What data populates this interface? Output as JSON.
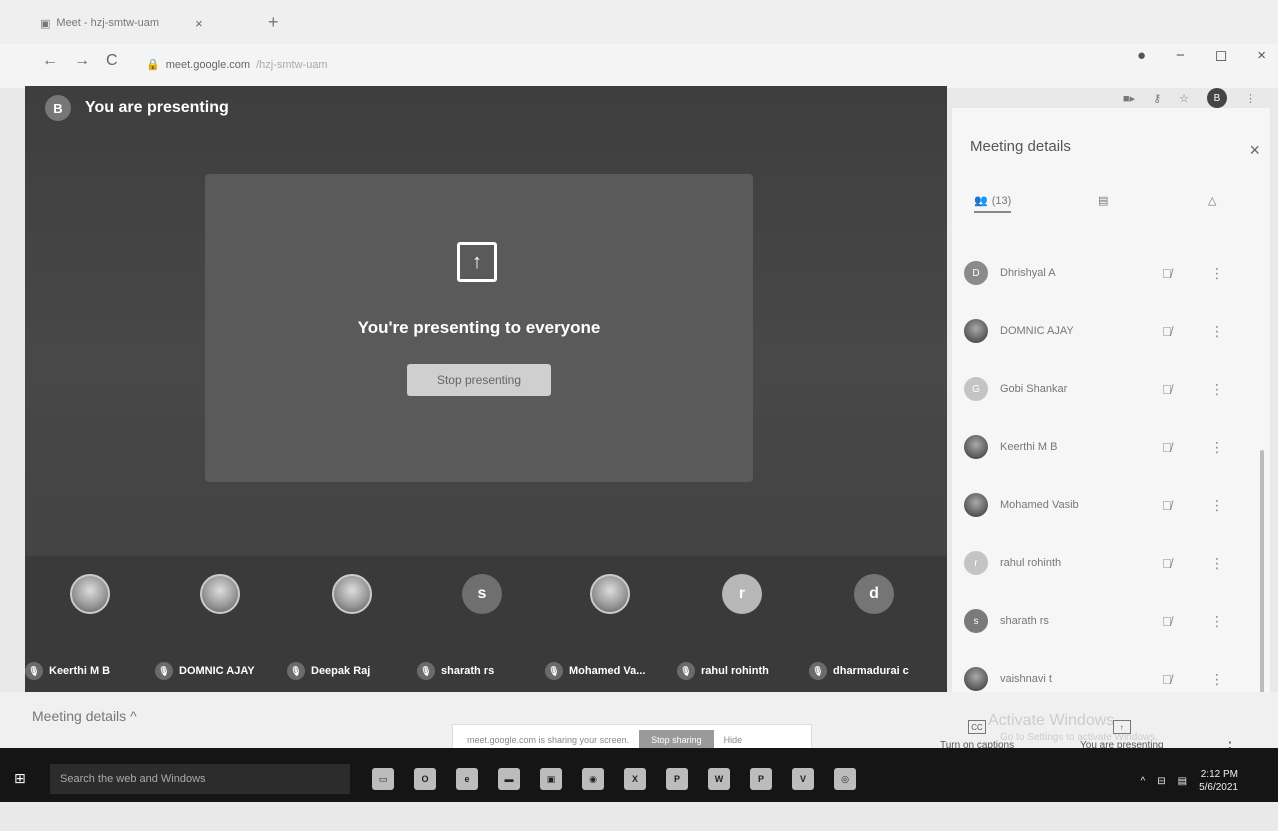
{
  "browser": {
    "tab_title": "Meet - hzj-smtw-uam",
    "tab_close": "×",
    "new_tab": "+",
    "url_host": "meet.google.com",
    "url_path": "/hzj-smtw-uam",
    "nav_back": "←",
    "nav_forward": "→",
    "nav_reload": "C",
    "profile_initial": "B",
    "window_min": "−",
    "window_max": "◻",
    "window_close": "×"
  },
  "stage": {
    "presenter_initial": "B",
    "banner_text": "You are presenting",
    "present_title": "You're presenting to everyone",
    "stop_presenting_label": "Stop presenting",
    "participants": [
      {
        "name": "Keerthi M B",
        "initial": "",
        "photo": true,
        "color": "#777777"
      },
      {
        "name": "DOMNIC AJAY",
        "initial": "",
        "photo": true,
        "color": "#777777"
      },
      {
        "name": "Deepak Raj",
        "initial": "",
        "photo": true,
        "color": "#777777"
      },
      {
        "name": "sharath rs",
        "initial": "s",
        "photo": false,
        "color": "#6f6f6f"
      },
      {
        "name": "Mohamed Va...",
        "initial": "",
        "photo": true,
        "color": "#777777"
      },
      {
        "name": "rahul rohinth",
        "initial": "r",
        "photo": false,
        "color": "#b7b7b7"
      },
      {
        "name": "dharmadurai c",
        "initial": "d",
        "photo": false,
        "color": "#757575"
      }
    ]
  },
  "panel": {
    "title": "Meeting details",
    "close": "×",
    "people_count": "(13)",
    "people": [
      {
        "name": "Dhrishyal A",
        "initial": "D",
        "photo": false,
        "color": "#8a8a8a"
      },
      {
        "name": "DOMNIC AJAY",
        "initial": "",
        "photo": true,
        "color": "#777777"
      },
      {
        "name": "Gobi Shankar",
        "initial": "G",
        "photo": false,
        "color": "#c4c4c4"
      },
      {
        "name": "Keerthi M B",
        "initial": "",
        "photo": true,
        "color": "#777777"
      },
      {
        "name": "Mohamed Vasib",
        "initial": "",
        "photo": true,
        "color": "#777777"
      },
      {
        "name": "rahul rohinth",
        "initial": "r",
        "photo": false,
        "color": "#c4c4c4"
      },
      {
        "name": "sharath rs",
        "initial": "s",
        "photo": false,
        "color": "#7a7a7a"
      },
      {
        "name": "vaishnavi t",
        "initial": "",
        "photo": true,
        "color": "#777777"
      }
    ]
  },
  "bottom": {
    "meeting_details": "Meeting details",
    "share_text": "meet.google.com is sharing your screen.",
    "stop_sharing": "Stop sharing",
    "hide": "Hide",
    "captions": "Turn on captions",
    "presenting": "You are presenting",
    "activate_title": "Activate Windows",
    "activate_sub": "Go to Settings to activate Windows."
  },
  "taskbar": {
    "search_placeholder": "Search the web and Windows",
    "time": "2:12 PM",
    "date": "5/6/2021"
  }
}
